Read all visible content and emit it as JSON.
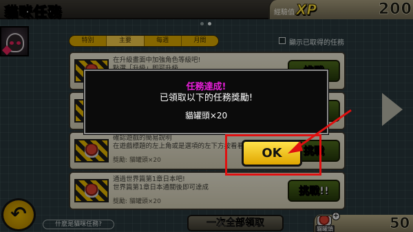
{
  "header": {
    "title": "貓咪任務",
    "xp_label": "經驗值",
    "xp_logo": "XP",
    "xp_value": "200"
  },
  "tabs": [
    {
      "label": "特別"
    },
    {
      "label": "主要"
    },
    {
      "label": "每週"
    },
    {
      "label": "月間"
    }
  ],
  "filter": {
    "label": "顯示已取得的任務",
    "checked": false
  },
  "missions": [
    {
      "line1": "在升級畫面中加強角色等級吧!",
      "line2": "點選「升級」即可升級",
      "button": "挑戰"
    },
    {
      "line1": "",
      "line2": "",
      "button": ""
    },
    {
      "line1": "確認遊戲的簡易說明",
      "line2": "在遊戲標題的左上角或是選項的左下方按看看",
      "reward": "獎勵: 貓罐頭×20",
      "button": "挑戰"
    },
    {
      "line1": "通過世界篇第1章日本吧!",
      "line2": "世界篇第1章日本通關後即可達成",
      "reward": "獎勵: 貓罐頭×20",
      "button": "挑戰!!"
    }
  ],
  "footer": {
    "help_label": "什麼是貓咪任務?",
    "claim_all_label": "一次全部領取",
    "currency_label": "貓罐頭",
    "currency_value": "50"
  },
  "dialog": {
    "title": "任務達成!",
    "message": "已領取以下的任務獎勵!",
    "reward": "貓罐頭×20",
    "ok_label": "OK"
  },
  "colors": {
    "accent_yellow": "#e0a600",
    "dialog_title": "#e81fd9",
    "highlight_red": "#e01010",
    "challenge_green": "#3a5414"
  }
}
